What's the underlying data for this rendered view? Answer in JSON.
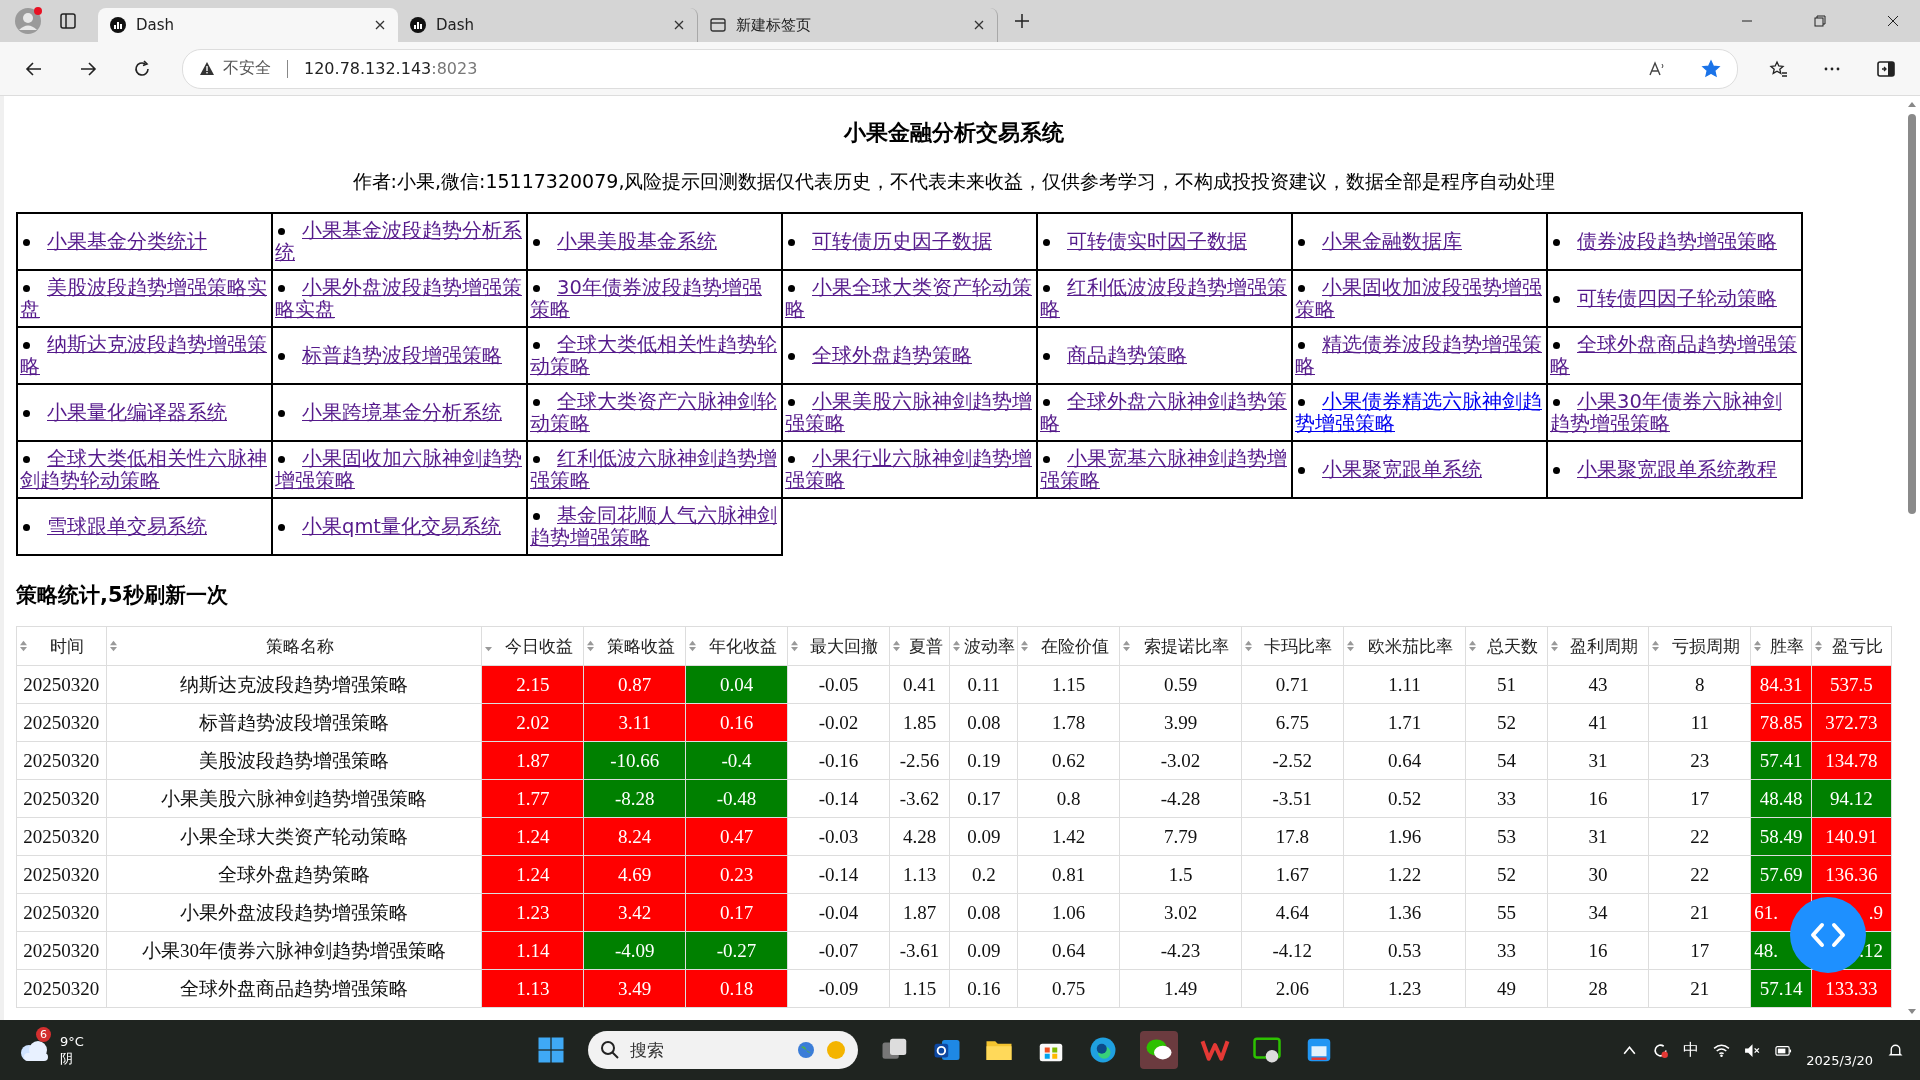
{
  "browser": {
    "tabs": [
      {
        "title": "Dash",
        "selected": true
      },
      {
        "title": "Dash",
        "selected": false
      },
      {
        "title": "新建标签页",
        "selected": false
      }
    ],
    "security": "不安全",
    "url_host": "120.78.132.143",
    "url_port": ":8023",
    "favorited": true
  },
  "page": {
    "title": "小果金融分析交易系统",
    "subtitle": "作者:小果,微信:15117320079,风险提示回测数据仅代表历史，不代表未来收益，仅供参考学习，不构成投投资建议，数据全部是程序自动处理",
    "links": [
      {
        "label": "小果基金分类统计",
        "visited": true
      },
      {
        "label": "小果基金波段趋势分析系统",
        "visited": true
      },
      {
        "label": "小果美股基金系统",
        "visited": true
      },
      {
        "label": "可转债历史因子数据",
        "visited": true
      },
      {
        "label": "可转债实时因子数据",
        "visited": true
      },
      {
        "label": "小果金融数据库",
        "visited": true
      },
      {
        "label": "债券波段趋势增强策略",
        "visited": true
      },
      {
        "label": "美股波段趋势增强策略实盘",
        "visited": true
      },
      {
        "label": "小果外盘波段趋势增强策略实盘",
        "visited": true
      },
      {
        "label": "30年债券波段趋势增强策略",
        "visited": true
      },
      {
        "label": "小果全球大类资产轮动策略",
        "visited": true
      },
      {
        "label": "红利低波波段趋势增强策略",
        "visited": true
      },
      {
        "label": "小果固收加波段强势增强策略",
        "visited": true
      },
      {
        "label": "可转债四因子轮动策略",
        "visited": true
      },
      {
        "label": "纳斯达克波段趋势增强策略",
        "visited": true
      },
      {
        "label": "标普趋势波段增强策略",
        "visited": true
      },
      {
        "label": "全球大类低相关性趋势轮动策略",
        "visited": true
      },
      {
        "label": "全球外盘趋势策略",
        "visited": true
      },
      {
        "label": "商品趋势策略",
        "visited": true
      },
      {
        "label": "精选债券波段趋势增强策略",
        "visited": true
      },
      {
        "label": "全球外盘商品趋势增强策略",
        "visited": true
      },
      {
        "label": "小果量化编译器系统",
        "visited": true
      },
      {
        "label": "小果跨境基金分析系统",
        "visited": true
      },
      {
        "label": "全球大类资产六脉神剑轮动策略",
        "visited": true
      },
      {
        "label": "小果美股六脉神剑趋势增强策略",
        "visited": true
      },
      {
        "label": "全球外盘六脉神剑趋势策略",
        "visited": true
      },
      {
        "label": "小果债券精选六脉神剑趋势增强策略",
        "visited": false
      },
      {
        "label": "小果30年债券六脉神剑趋势增强策略",
        "visited": true
      },
      {
        "label": "全球大类低相关性六脉神剑趋势轮动策略",
        "visited": true
      },
      {
        "label": "小果固收加六脉神剑趋势增强策略",
        "visited": true
      },
      {
        "label": "红利低波六脉神剑趋势增强策略",
        "visited": true
      },
      {
        "label": "小果行业六脉神剑趋势增强策略",
        "visited": true
      },
      {
        "label": "小果宽基六脉神剑趋势增强策略",
        "visited": true
      },
      {
        "label": "小果聚宽跟单系统",
        "visited": true
      },
      {
        "label": "小果聚宽跟单系统教程",
        "visited": true
      },
      {
        "label": "雪球跟单交易系统",
        "visited": true
      },
      {
        "label": "小果qmt量化交易系统",
        "visited": true
      },
      {
        "label": "基金同花顺人气六脉神剑趋势增强策略",
        "visited": true
      }
    ],
    "section_title": "策略统计,5秒刷新一次"
  },
  "table": {
    "columns": [
      {
        "label": "时间",
        "sorted_descending": false
      },
      {
        "label": "策略名称",
        "sorted_descending": false
      },
      {
        "label": "今日收益",
        "sorted_descending": true
      },
      {
        "label": "策略收益",
        "sorted_descending": false
      },
      {
        "label": "年化收益",
        "sorted_descending": false
      },
      {
        "label": "最大回撤",
        "sorted_descending": false
      },
      {
        "label": "夏普",
        "sorted_descending": false
      },
      {
        "label": "波动率",
        "sorted_descending": false
      },
      {
        "label": "在险价值",
        "sorted_descending": false
      },
      {
        "label": "索提诺比率",
        "sorted_descending": false
      },
      {
        "label": "卡玛比率",
        "sorted_descending": false
      },
      {
        "label": "欧米茄比率",
        "sorted_descending": false
      },
      {
        "label": "总天数",
        "sorted_descending": false
      },
      {
        "label": "盈利周期",
        "sorted_descending": false
      },
      {
        "label": "亏损周期",
        "sorted_descending": false
      },
      {
        "label": "胜率",
        "sorted_descending": false
      },
      {
        "label": "盈亏比",
        "sorted_descending": false
      }
    ],
    "rows": [
      {
        "cells": [
          {
            "text": "20250320"
          },
          {
            "text": "纳斯达克波段趋势增强策略"
          },
          {
            "text": "2.15",
            "color": "#ff0000"
          },
          {
            "text": "0.87",
            "color": "#ff0000"
          },
          {
            "text": "0.04",
            "color": "#008000"
          },
          {
            "text": "-0.05"
          },
          {
            "text": "0.41"
          },
          {
            "text": "0.11"
          },
          {
            "text": "1.15"
          },
          {
            "text": "0.59"
          },
          {
            "text": "0.71"
          },
          {
            "text": "1.11"
          },
          {
            "text": "51"
          },
          {
            "text": "43"
          },
          {
            "text": "8"
          },
          {
            "text": "84.31",
            "color": "#ff0000"
          },
          {
            "text": "537.5",
            "color": "#ff0000"
          }
        ]
      },
      {
        "cells": [
          {
            "text": "20250320"
          },
          {
            "text": "标普趋势波段增强策略"
          },
          {
            "text": "2.02",
            "color": "#ff0000"
          },
          {
            "text": "3.11",
            "color": "#ff0000"
          },
          {
            "text": "0.16",
            "color": "#ff0000"
          },
          {
            "text": "-0.02"
          },
          {
            "text": "1.85"
          },
          {
            "text": "0.08"
          },
          {
            "text": "1.78"
          },
          {
            "text": "3.99"
          },
          {
            "text": "6.75"
          },
          {
            "text": "1.71"
          },
          {
            "text": "52"
          },
          {
            "text": "41"
          },
          {
            "text": "11"
          },
          {
            "text": "78.85",
            "color": "#ff0000"
          },
          {
            "text": "372.73",
            "color": "#ff0000"
          }
        ]
      },
      {
        "cells": [
          {
            "text": "20250320"
          },
          {
            "text": "美股波段趋势增强策略"
          },
          {
            "text": "1.87",
            "color": "#ff0000"
          },
          {
            "text": "-10.66",
            "color": "#008000"
          },
          {
            "text": "-0.4",
            "color": "#008000"
          },
          {
            "text": "-0.16"
          },
          {
            "text": "-2.56"
          },
          {
            "text": "0.19"
          },
          {
            "text": "0.62"
          },
          {
            "text": "-3.02"
          },
          {
            "text": "-2.52"
          },
          {
            "text": "0.64"
          },
          {
            "text": "54"
          },
          {
            "text": "31"
          },
          {
            "text": "23"
          },
          {
            "text": "57.41",
            "color": "#008000"
          },
          {
            "text": "134.78",
            "color": "#ff0000"
          }
        ]
      },
      {
        "cells": [
          {
            "text": "20250320"
          },
          {
            "text": "小果美股六脉神剑趋势增强策略"
          },
          {
            "text": "1.77",
            "color": "#ff0000"
          },
          {
            "text": "-8.28",
            "color": "#008000"
          },
          {
            "text": "-0.48",
            "color": "#008000"
          },
          {
            "text": "-0.14"
          },
          {
            "text": "-3.62"
          },
          {
            "text": "0.17"
          },
          {
            "text": "0.8"
          },
          {
            "text": "-4.28"
          },
          {
            "text": "-3.51"
          },
          {
            "text": "0.52"
          },
          {
            "text": "33"
          },
          {
            "text": "16"
          },
          {
            "text": "17"
          },
          {
            "text": "48.48",
            "color": "#008000"
          },
          {
            "text": "94.12",
            "color": "#008000"
          }
        ]
      },
      {
        "cells": [
          {
            "text": "20250320"
          },
          {
            "text": "小果全球大类资产轮动策略"
          },
          {
            "text": "1.24",
            "color": "#ff0000"
          },
          {
            "text": "8.24",
            "color": "#ff0000"
          },
          {
            "text": "0.47",
            "color": "#ff0000"
          },
          {
            "text": "-0.03"
          },
          {
            "text": "4.28"
          },
          {
            "text": "0.09"
          },
          {
            "text": "1.42"
          },
          {
            "text": "7.79"
          },
          {
            "text": "17.8"
          },
          {
            "text": "1.96"
          },
          {
            "text": "53"
          },
          {
            "text": "31"
          },
          {
            "text": "22"
          },
          {
            "text": "58.49",
            "color": "#008000"
          },
          {
            "text": "140.91",
            "color": "#ff0000"
          }
        ]
      },
      {
        "cells": [
          {
            "text": "20250320"
          },
          {
            "text": "全球外盘趋势策略"
          },
          {
            "text": "1.24",
            "color": "#ff0000"
          },
          {
            "text": "4.69",
            "color": "#ff0000"
          },
          {
            "text": "0.23",
            "color": "#ff0000"
          },
          {
            "text": "-0.14"
          },
          {
            "text": "1.13"
          },
          {
            "text": "0.2"
          },
          {
            "text": "0.81"
          },
          {
            "text": "1.5"
          },
          {
            "text": "1.67"
          },
          {
            "text": "1.22"
          },
          {
            "text": "52"
          },
          {
            "text": "30"
          },
          {
            "text": "22"
          },
          {
            "text": "57.69",
            "color": "#008000"
          },
          {
            "text": "136.36",
            "color": "#ff0000"
          }
        ]
      },
      {
        "cells": [
          {
            "text": "20250320"
          },
          {
            "text": "小果外盘波段趋势增强策略"
          },
          {
            "text": "1.23",
            "color": "#ff0000"
          },
          {
            "text": "3.42",
            "color": "#ff0000"
          },
          {
            "text": "0.17",
            "color": "#ff0000"
          },
          {
            "text": "-0.04"
          },
          {
            "text": "1.87"
          },
          {
            "text": "0.08"
          },
          {
            "text": "1.06"
          },
          {
            "text": "3.02"
          },
          {
            "text": "4.64"
          },
          {
            "text": "1.36"
          },
          {
            "text": "55"
          },
          {
            "text": "34"
          },
          {
            "text": "21"
          },
          {
            "text": "61.",
            "color": "#ff0000",
            "left_aligned": true
          },
          {
            "text": ".9",
            "color": "#ff0000",
            "right_aligned": true
          }
        ]
      },
      {
        "cells": [
          {
            "text": "20250320"
          },
          {
            "text": "小果30年债券六脉神剑趋势增强策略"
          },
          {
            "text": "1.14",
            "color": "#ff0000"
          },
          {
            "text": "-4.09",
            "color": "#008000"
          },
          {
            "text": "-0.27",
            "color": "#008000"
          },
          {
            "text": "-0.07"
          },
          {
            "text": "-3.61"
          },
          {
            "text": "0.09"
          },
          {
            "text": "0.64"
          },
          {
            "text": "-4.23"
          },
          {
            "text": "-4.12"
          },
          {
            "text": "0.53"
          },
          {
            "text": "33"
          },
          {
            "text": "16"
          },
          {
            "text": "17"
          },
          {
            "text": "48.",
            "color": "#008000",
            "left_aligned": true
          },
          {
            "text": ".12",
            "color": "#008000",
            "right_aligned": true
          }
        ]
      },
      {
        "cells": [
          {
            "text": "20250320"
          },
          {
            "text": "全球外盘商品趋势增强策略"
          },
          {
            "text": "1.13",
            "color": "#ff0000"
          },
          {
            "text": "3.49",
            "color": "#ff0000"
          },
          {
            "text": "0.18",
            "color": "#ff0000"
          },
          {
            "text": "-0.09"
          },
          {
            "text": "1.15"
          },
          {
            "text": "0.16"
          },
          {
            "text": "0.75"
          },
          {
            "text": "1.49"
          },
          {
            "text": "2.06"
          },
          {
            "text": "1.23"
          },
          {
            "text": "49"
          },
          {
            "text": "28"
          },
          {
            "text": "21"
          },
          {
            "text": "57.14",
            "color": "#008000"
          },
          {
            "text": "133.33",
            "color": "#ff0000"
          }
        ]
      }
    ]
  },
  "taskbar": {
    "weather": {
      "badge": "6",
      "temperature": "9°C",
      "condition": "阴"
    },
    "search_placeholder": "搜索",
    "ime": "中",
    "date": "2025/3/20"
  }
}
